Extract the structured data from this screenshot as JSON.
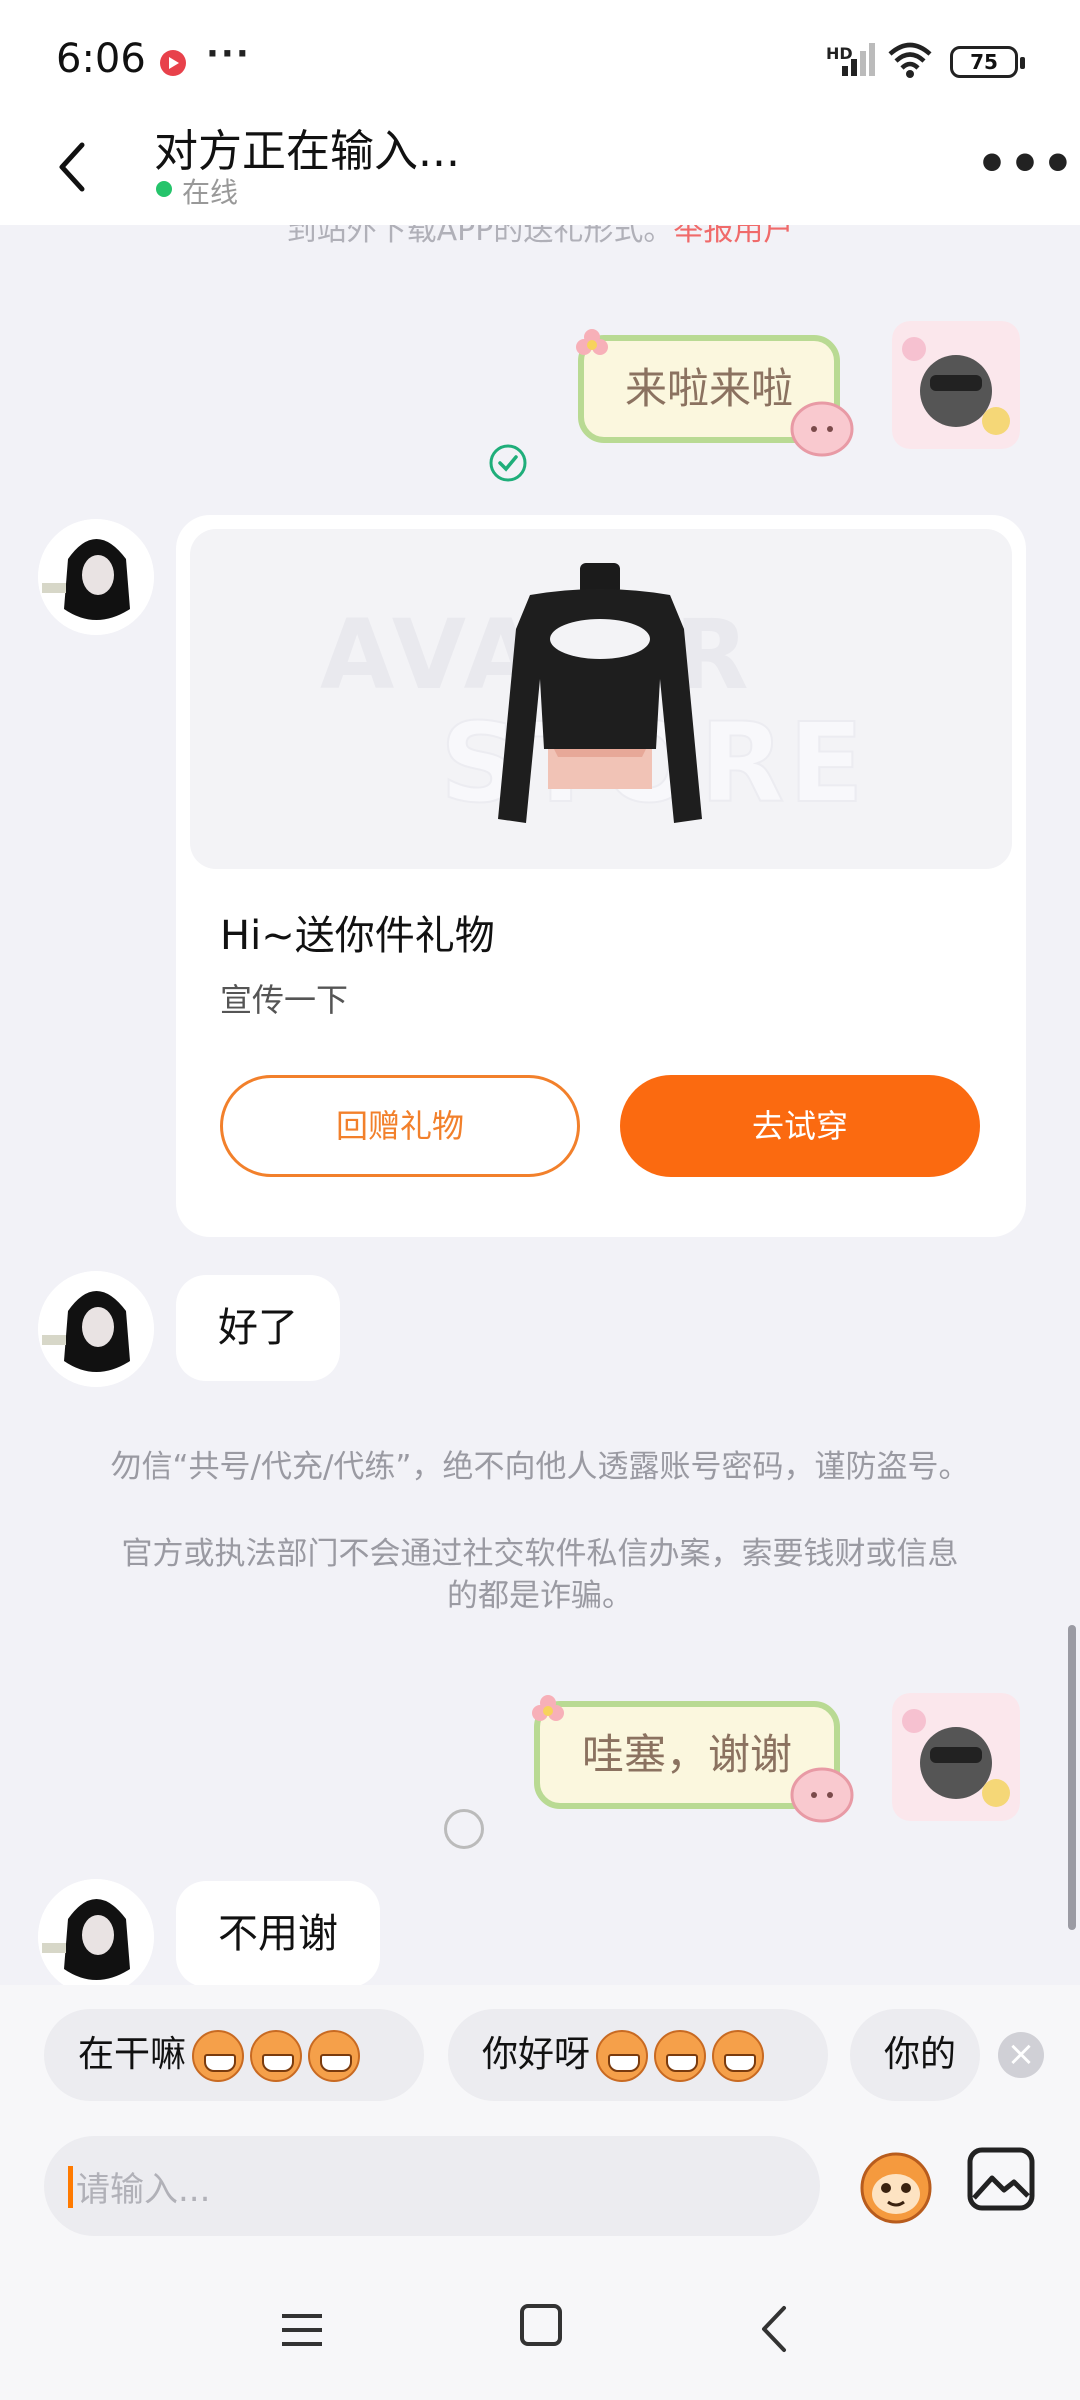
{
  "status_bar": {
    "time": "6:06",
    "more": "···",
    "hd": "HD",
    "battery": "75"
  },
  "header": {
    "title": "对方正在输入...",
    "status": "在线",
    "more": "•••"
  },
  "chat": {
    "top_notice": "到站外下载APP的送礼形式。",
    "top_notice_link": "举报用户",
    "messages": [
      {
        "from": "self",
        "type": "sticker",
        "text": "来啦来啦",
        "status": "read"
      },
      {
        "from": "peer",
        "type": "gift_card"
      },
      {
        "from": "peer",
        "type": "text",
        "text": "好了"
      },
      {
        "from": "self",
        "type": "sticker",
        "text": "哇塞，谢谢",
        "status": "sending"
      },
      {
        "from": "peer",
        "type": "text",
        "text": "不用谢"
      }
    ],
    "gift_card": {
      "watermark_line1": "AVATAR",
      "watermark_line2": "STORE",
      "title": "Hi~送你件礼物",
      "subtitle": "宣传一下",
      "return_button": "回赠礼物",
      "try_button": "去试穿"
    },
    "warning": {
      "line1": "勿信“共号/代充/代练”，绝不向他人透露账号密码，谨防盗号。",
      "line2": "官方或执法部门不会通过社交软件私信办案，索要钱财或信息",
      "line3": "的都是诈骗。"
    }
  },
  "quick_replies": {
    "items": [
      {
        "text": "在干嘛",
        "emoji": "grin-monkey-emoji"
      },
      {
        "text": "你好呀",
        "emoji": "wide-eye-monkey-emoji"
      },
      {
        "text": "你的",
        "emoji": ""
      }
    ],
    "close": "×"
  },
  "input": {
    "placeholder": "请输入..."
  },
  "colors": {
    "accent": "#fb6a10",
    "online": "#25c46b",
    "sticker_border": "#b9da93",
    "report": "#f06a6a"
  }
}
